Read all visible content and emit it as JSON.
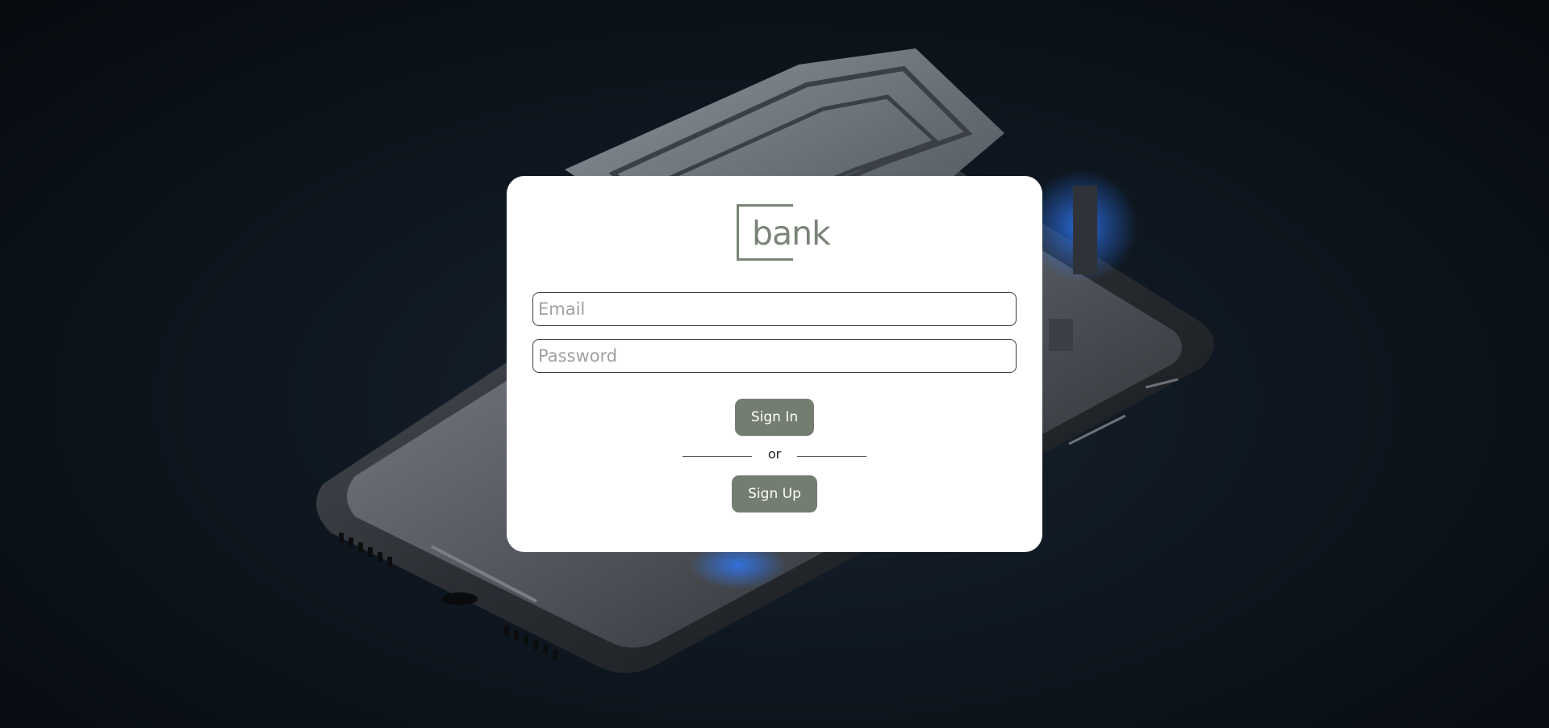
{
  "login": {
    "logo_text": "bank",
    "email": {
      "placeholder": "Email",
      "value": ""
    },
    "password": {
      "placeholder": "Password",
      "value": ""
    },
    "sign_in_label": "Sign In",
    "divider_text": "or",
    "sign_up_label": "Sign Up"
  },
  "colors": {
    "accent": "#737d70",
    "background": "#0e1720",
    "card": "#ffffff"
  },
  "icons": [
    "bank-logo-icon"
  ]
}
